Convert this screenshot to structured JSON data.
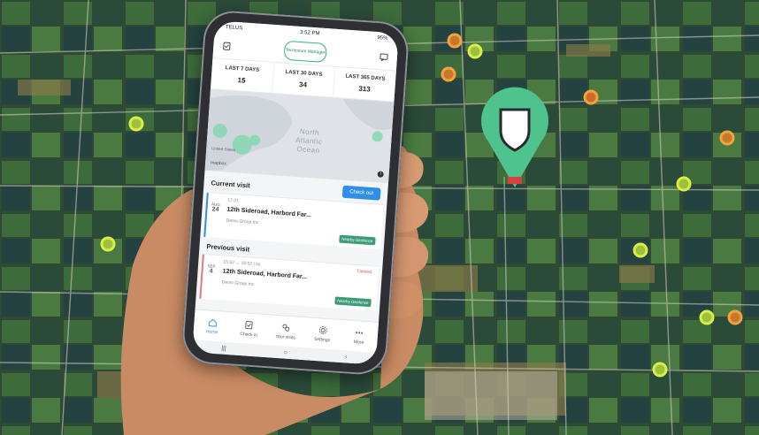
{
  "status_bar": {
    "carrier": "TELUS",
    "time": "3:52 PM",
    "battery": "95%"
  },
  "app": {
    "logo_text": "Territorium Manager"
  },
  "stats": [
    {
      "label": "LAST 7 DAYS",
      "value": "15"
    },
    {
      "label": "LAST 30 DAYS",
      "value": "34"
    },
    {
      "label": "LAST 365 DAYS",
      "value": "313"
    }
  ],
  "map": {
    "ocean_label_1": "North",
    "ocean_label_2": "Atlantic",
    "ocean_label_3": "Ocean",
    "land_label": "United States",
    "attribution": "mapbox"
  },
  "current_visit": {
    "title": "Current visit",
    "checkout_label": "Check out",
    "month": "AUG",
    "day": "24",
    "time": "17:21",
    "address": "12th Sideroad, Harbord Far...",
    "company": "Demo Group Inc",
    "badge": "Nearby Geofence"
  },
  "previous_visit": {
    "title": "Previous visit",
    "month": "SEP",
    "day": "4",
    "time": "15:52 → 15:52  |  5s",
    "status": "Denied",
    "address": "12th Sideroad, Harbord Far...",
    "company": "Demo Group Inc",
    "badge": "Nearby Geofence"
  },
  "nav": [
    {
      "label": "Home",
      "icon": "home-icon"
    },
    {
      "label": "Check in",
      "icon": "check-in-icon"
    },
    {
      "label": "Your visits",
      "icon": "visits-icon"
    },
    {
      "label": "Settings",
      "icon": "settings-icon"
    },
    {
      "label": "More",
      "icon": "more-icon"
    }
  ],
  "colors": {
    "accent": "#2f8ee8",
    "brand_green": "#4fc38d",
    "geofence_badge": "#3f9a77",
    "denied": "#d9534f"
  }
}
